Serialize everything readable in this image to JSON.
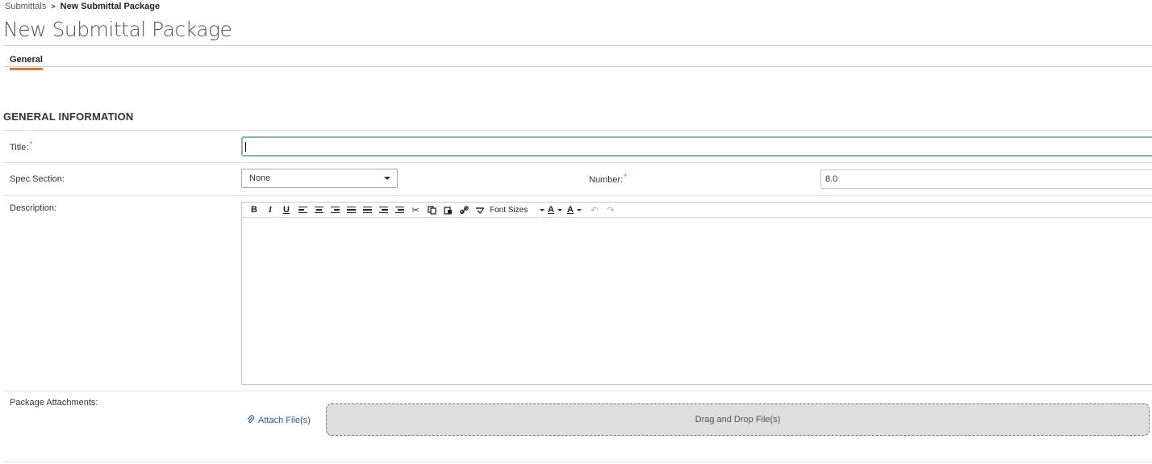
{
  "breadcrumb": {
    "parent": "Submittals",
    "current": "New Submittal Package"
  },
  "page": {
    "title": "New Submittal Package"
  },
  "tabs": [
    {
      "label": "General",
      "active": true
    }
  ],
  "section": {
    "heading": "GENERAL INFORMATION"
  },
  "fields": {
    "title": {
      "label": "Title:",
      "required": "*",
      "value": ""
    },
    "spec_section": {
      "label": "Spec Section:",
      "selected": "None"
    },
    "number": {
      "label": "Number:",
      "required": "*",
      "value": "8.0"
    },
    "description": {
      "label": "Description:",
      "font_sizes_label": "Font Sizes"
    },
    "attachments": {
      "label": "Package Attachments:",
      "attach_link": "Attach File(s)",
      "dropzone_text": "Drag and Drop File(s)"
    }
  },
  "icons": {
    "bold": "B",
    "italic": "I",
    "underline": "U",
    "font_color": "A",
    "highlight_color": "A",
    "cut": "✂",
    "link": "🔗",
    "undo": "↶",
    "redo": "↷",
    "paperclip": "📎"
  },
  "colors": {
    "accent": "#e8732c",
    "link": "#2b5e8c",
    "focus_border": "#7fb1c8"
  }
}
